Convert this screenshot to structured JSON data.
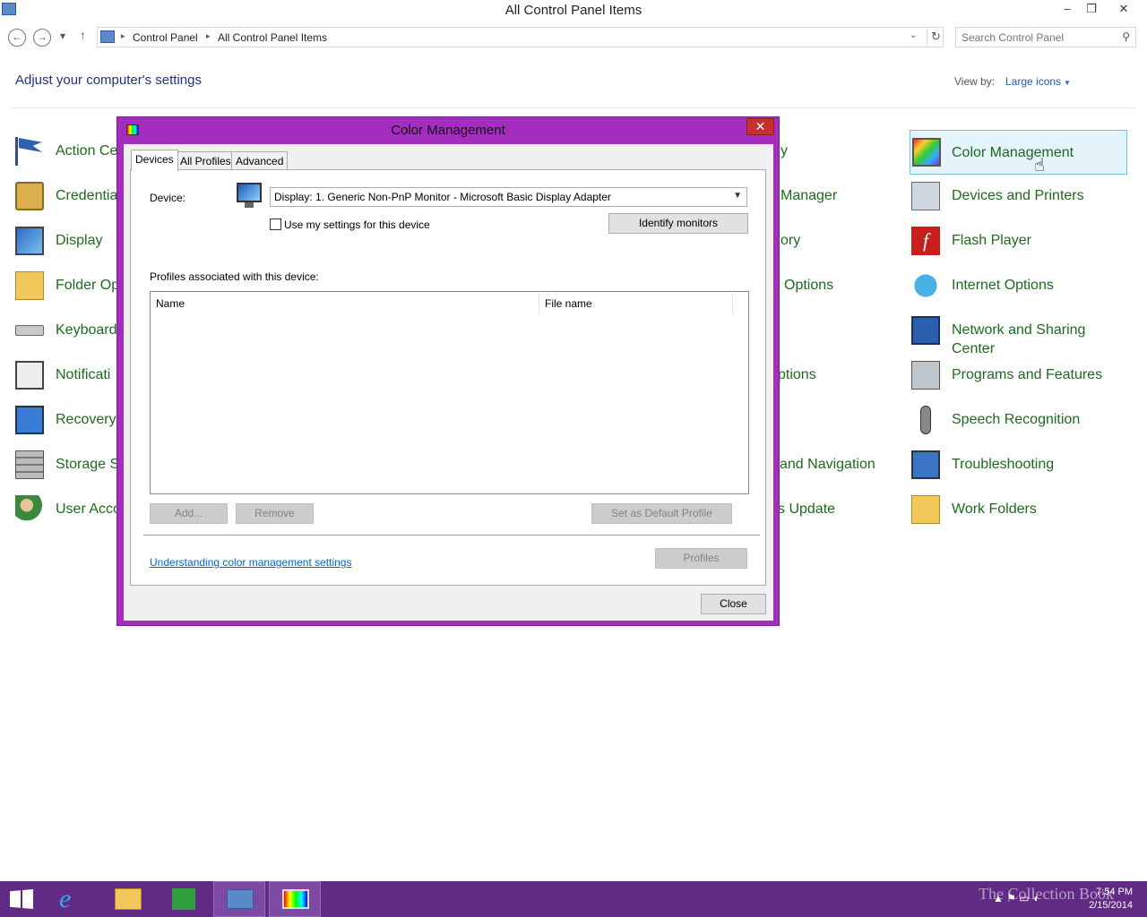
{
  "window": {
    "title": "All Control Panel Items",
    "min": "–",
    "max": "❐",
    "close": "✕"
  },
  "nav": {
    "back": "←",
    "forward": "→",
    "recent": "▾",
    "up": "↑"
  },
  "address": {
    "crumbs": [
      "Control Panel",
      "All Control Panel Items"
    ],
    "separator": "▸",
    "dropdown": "⌄",
    "refresh": "↻"
  },
  "search": {
    "placeholder": "Search Control Panel",
    "icon": "search-icon"
  },
  "header": {
    "title": "Adjust your computer's settings",
    "view_by_label": "View by:",
    "view_by_value": "Large icons"
  },
  "items": {
    "col1": [
      "Action Ce",
      "Credentia",
      "Display",
      "Folder Op",
      "Keyboard",
      "Notificati",
      "Recovery",
      "Storage S",
      "User Acco"
    ],
    "col3": [
      "y",
      "Manager",
      "ory",
      "Options",
      "",
      "ptions",
      "",
      "and Navigation",
      "s Update"
    ],
    "col4": [
      "Color Management",
      "Devices and Printers",
      "Flash Player",
      "Internet Options",
      "Network and Sharing Center",
      "Programs and Features",
      "Speech Recognition",
      "Troubleshooting",
      "Work Folders"
    ]
  },
  "dialog": {
    "title": "Color Management",
    "close": "✕",
    "tabs": [
      "Devices",
      "All Profiles",
      "Advanced"
    ],
    "device_label": "Device:",
    "device_value": "Display: 1. Generic Non-PnP Monitor - Microsoft Basic Display Adapter",
    "use_my_settings": "Use my settings for this device",
    "identify_monitors": "Identify monitors",
    "profiles_label": "Profiles associated with this device:",
    "columns": [
      "Name",
      "File name"
    ],
    "add": "Add...",
    "remove": "Remove",
    "set_default": "Set as Default Profile",
    "link": "Understanding color management settings",
    "profiles_btn": "Profiles",
    "close_btn": "Close"
  },
  "taskbar": {
    "time": "7:54 PM",
    "date": "2/15/2014",
    "watermark": "The Collection Book"
  },
  "colors": {
    "accent_dialog": "#a42dbf",
    "taskbar": "#612a84",
    "link_green": "#1d6a1d",
    "heading": "#1e3287"
  }
}
